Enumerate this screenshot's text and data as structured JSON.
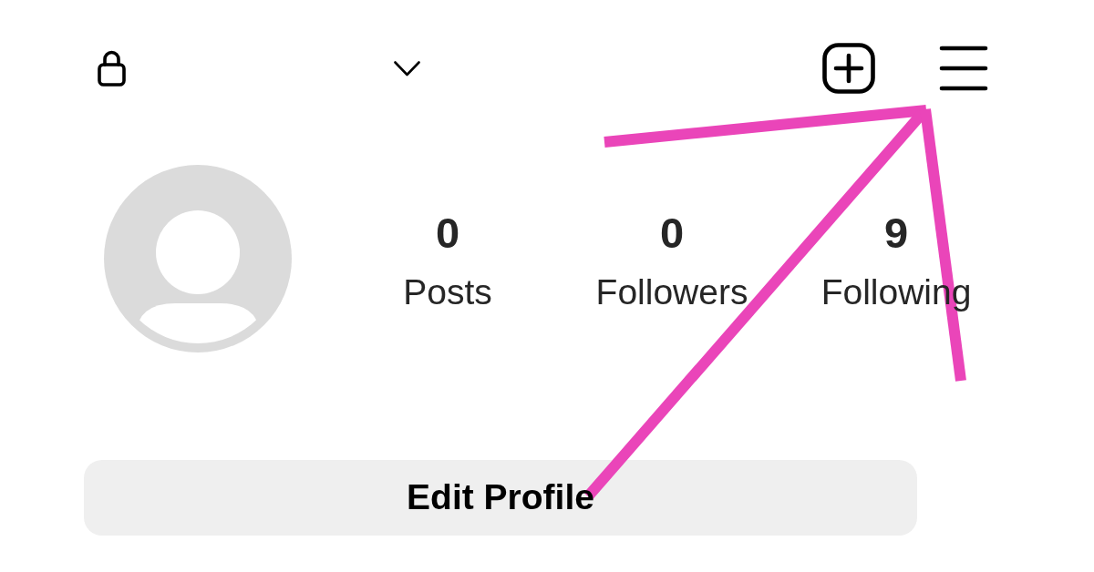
{
  "profile": {
    "stats": [
      {
        "count": "0",
        "label": "Posts"
      },
      {
        "count": "0",
        "label": "Followers"
      },
      {
        "count": "9",
        "label": "Following"
      }
    ]
  },
  "buttons": [
    {
      "label": "Edit Profile"
    }
  ]
}
